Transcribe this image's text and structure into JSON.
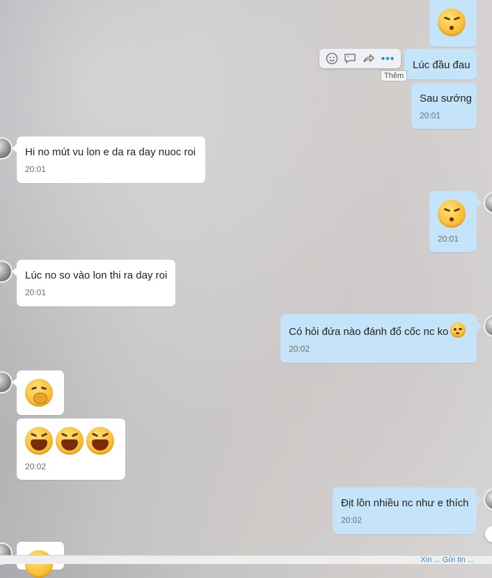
{
  "messages": {
    "m1": {
      "text": "Lúc đầu đau"
    },
    "m2": {
      "text": "Sau sướng",
      "time": "20:01"
    },
    "m3": {
      "text": "Hi no mút vu lon e da ra day nuoc roi",
      "time": "20:01"
    },
    "m4": {
      "time": "20:01"
    },
    "m5": {
      "text": "Lúc no so vào lon thi ra day roi",
      "time": "20:01"
    },
    "m6": {
      "text": "Có hỏi đứa nào đánh đổ cốc nc ko",
      "time": "20:02"
    },
    "m8": {
      "time": "20:02"
    },
    "m9": {
      "text": "Địt lồn nhiều nc như e thích",
      "time": "20:02"
    }
  },
  "toolbar": {
    "tooltip": "Thêm",
    "icons": [
      "smiley-icon",
      "quote-icon",
      "forward-icon",
      "more-icon",
      "star-icon"
    ]
  },
  "bottom": {
    "link": "Xin ... Gửi tin ..."
  },
  "colors": {
    "incoming": "#ffffff",
    "outgoing": "#c6e4f9",
    "accent": "#1e8ee0"
  }
}
